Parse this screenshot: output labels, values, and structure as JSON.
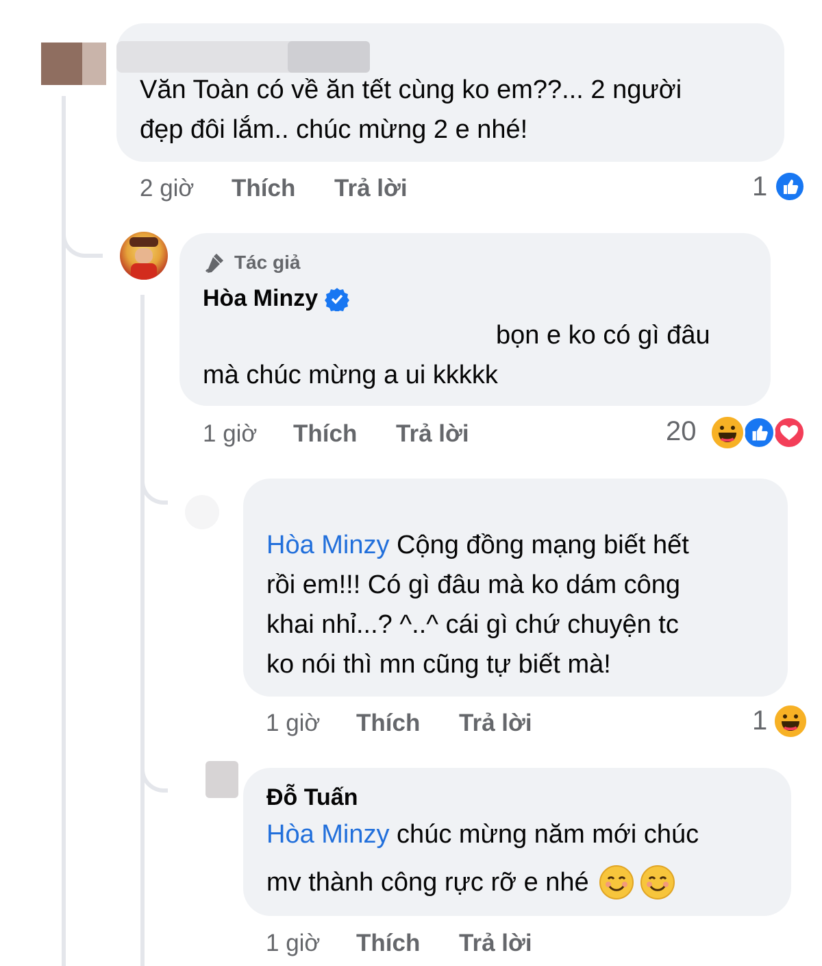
{
  "comment1": {
    "line1": "Văn Toàn có về ăn tết cùng ko em??... 2 người",
    "line2": "đẹp đôi lắm.. chúc mừng 2 e nhé!",
    "time": "2 giờ",
    "like_label": "Thích",
    "reply_label": "Trả lời",
    "reaction_count": "1"
  },
  "reply1": {
    "author_badge": "Tác giả",
    "author": "Hòa Minzy",
    "line1": "bọn e ko có gì đâu",
    "line2": "mà chúc mừng a ui kkkkk",
    "time": "1 giờ",
    "like_label": "Thích",
    "reply_label": "Trả lời",
    "reaction_count": "20"
  },
  "reply2": {
    "mention": "Hòa Minzy",
    "line1_rest": " Cộng đồng mạng biết hết",
    "line2": "rồi em!!! Có gì đâu mà ko dám công",
    "line3": "khai nhỉ...? ^..^ cái gì chứ chuyện tc",
    "line4": "ko nói thì mn cũng tự biết mà!",
    "time": "1 giờ",
    "like_label": "Thích",
    "reply_label": "Trả lời",
    "reaction_count": "1"
  },
  "reply3": {
    "author": "Đỗ Tuấn",
    "mention": "Hòa Minzy",
    "line1_rest": " chúc mừng năm mới chúc",
    "line2": "mv thành công rực rỡ e nhé",
    "time": "1 giờ",
    "like_label": "Thích",
    "reply_label": "Trả lời"
  },
  "colors": {
    "bubble": "#f0f2f5",
    "mention": "#216fdb",
    "meta": "#65676b",
    "like": "#1877f2",
    "haha": "#f7b125",
    "love": "#f33e58",
    "verified": "#1877f2"
  }
}
